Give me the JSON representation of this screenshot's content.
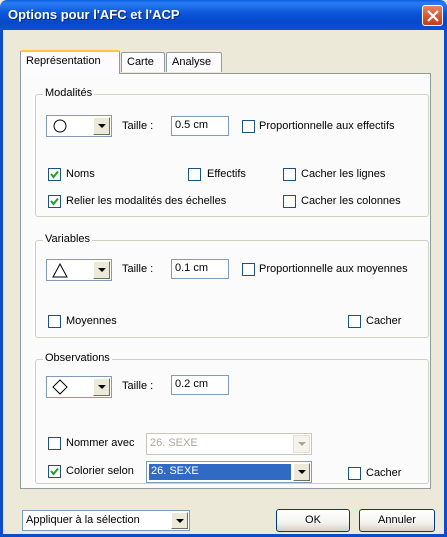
{
  "window": {
    "title": "Options pour l'AFC et l'ACP"
  },
  "tabs": [
    {
      "label": "Représentation",
      "active": true
    },
    {
      "label": "Carte",
      "active": false
    },
    {
      "label": "Analyse",
      "active": false
    }
  ],
  "modalites": {
    "title": "Modalités",
    "shape": "circle",
    "taille_label": "Taille :",
    "taille_value": "0.5 cm",
    "prop_label": "Proportionnelle aux effectifs",
    "prop_checked": false,
    "noms_label": "Noms",
    "noms_checked": true,
    "effectifs_label": "Effectifs",
    "effectifs_checked": false,
    "cacher_lignes_label": "Cacher les lignes",
    "cacher_lignes_checked": false,
    "relier_label": "Relier les modalités des échelles",
    "relier_checked": true,
    "cacher_colonnes_label": "Cacher les colonnes",
    "cacher_colonnes_checked": false
  },
  "variables": {
    "title": "Variables",
    "shape": "triangle",
    "taille_label": "Taille :",
    "taille_value": "0.1 cm",
    "prop_label": "Proportionnelle aux moyennes",
    "prop_checked": false,
    "moyennes_label": "Moyennes",
    "moyennes_checked": false,
    "cacher_label": "Cacher",
    "cacher_checked": false
  },
  "observations": {
    "title": "Observations",
    "shape": "diamond",
    "taille_label": "Taille :",
    "taille_value": "0.2 cm",
    "nommer_label": "Nommer avec",
    "nommer_checked": false,
    "nommer_value": "26. SEXE",
    "colorier_label": "Colorier selon",
    "colorier_checked": true,
    "colorier_value": "26. SEXE",
    "cacher_label": "Cacher",
    "cacher_checked": false
  },
  "footer": {
    "apply_value": "Appliquer à la sélection",
    "ok_label": "OK",
    "cancel_label": "Annuler"
  }
}
